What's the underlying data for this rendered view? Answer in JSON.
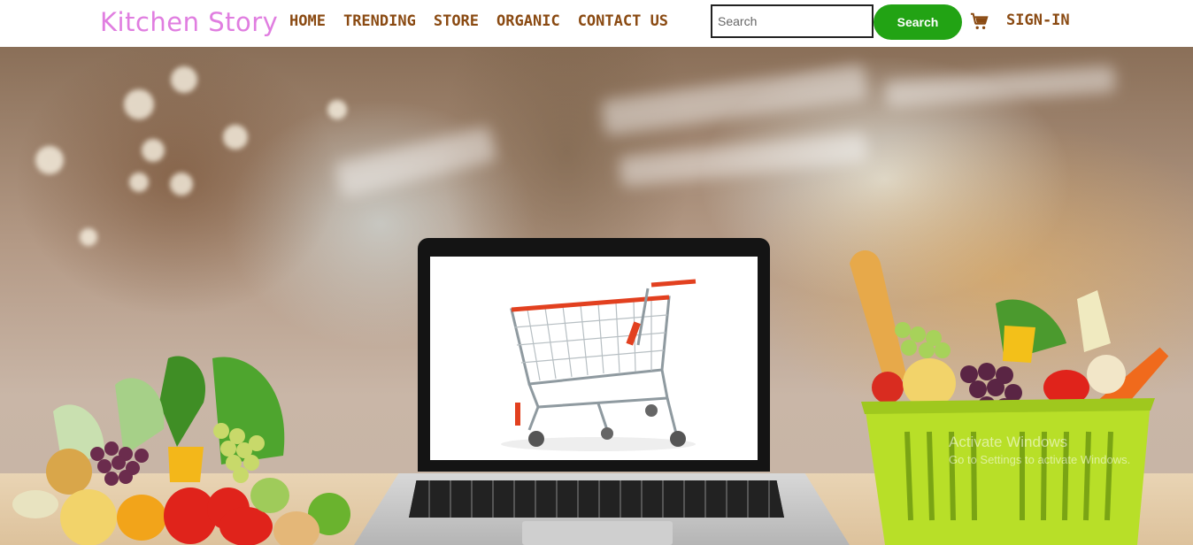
{
  "navbar": {
    "brand": "Kitchen Story",
    "links": [
      "HOME",
      "TRENDING",
      "STORE",
      "ORGANIC",
      "CONTACT US"
    ],
    "search": {
      "placeholder": "Search",
      "value": ""
    },
    "search_button": "Search",
    "cart_icon": "shopping-cart-icon",
    "signin": "SIGN-IN"
  },
  "hero": {
    "image": "grocery-store-laptop-cart-hero"
  },
  "watermark": {
    "title": "Activate Windows",
    "subtitle": "Go to Settings to activate Windows."
  },
  "colors": {
    "brand": "#e07ee0",
    "nav_link": "#8a4a12",
    "search_button": "#22a314"
  }
}
